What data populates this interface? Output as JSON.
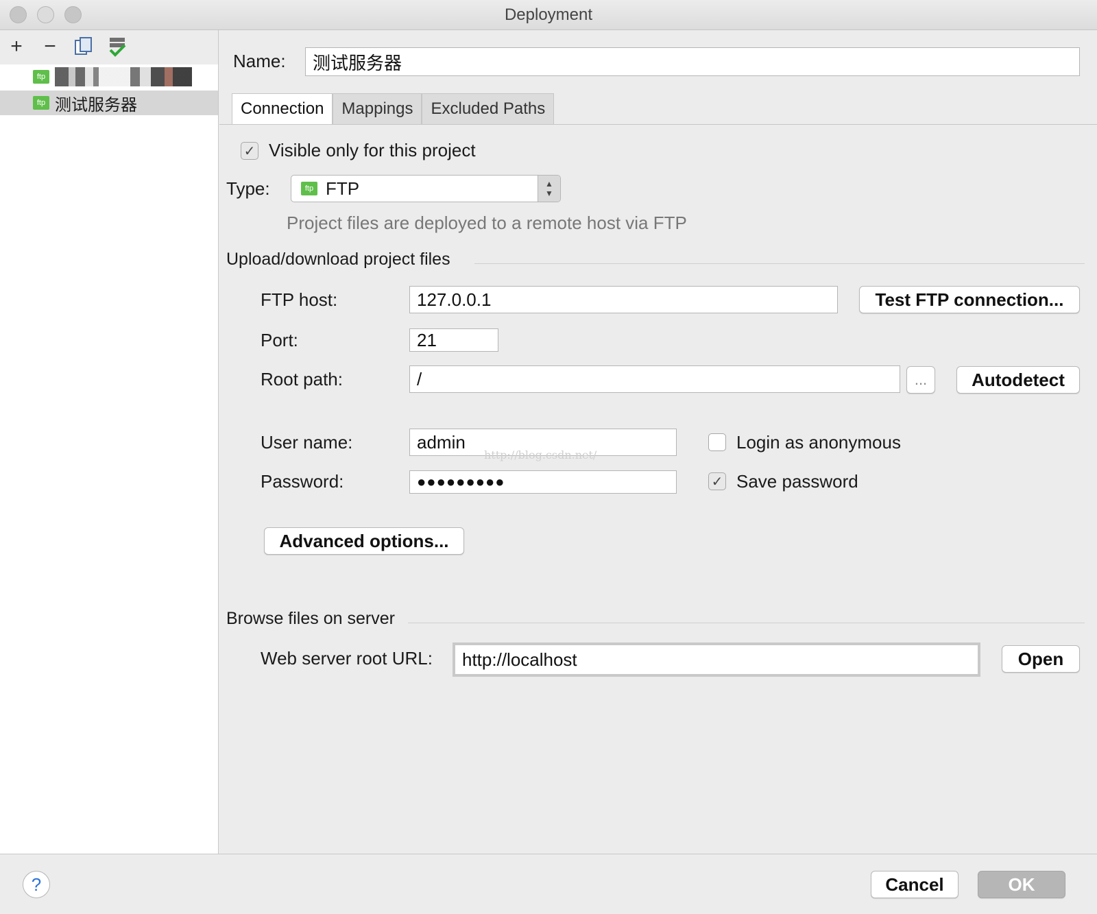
{
  "window": {
    "title": "Deployment"
  },
  "toolbar": {
    "add_icon": "+",
    "remove_icon": "−",
    "copy_icon": "copy-icon",
    "default_icon": "check-server-icon"
  },
  "servers": [
    {
      "name": "",
      "type_badge": "ftp"
    },
    {
      "name": "测试服务器",
      "type_badge": "ftp"
    }
  ],
  "form": {
    "name_label": "Name:",
    "name_value": "测试服务器",
    "tabs": [
      {
        "label": "Connection"
      },
      {
        "label": "Mappings"
      },
      {
        "label": "Excluded Paths"
      }
    ],
    "visible_only_label": "Visible only for this project",
    "visible_only_checked": "✓",
    "type_label": "Type:",
    "type_value": "FTP",
    "type_badge": "ftp",
    "type_hint": "Project files are deployed to a remote host via FTP",
    "upload_section": "Upload/download project files",
    "ftp_host_label": "FTP host:",
    "ftp_host_value": "127.0.0.1",
    "test_button": "Test FTP connection...",
    "port_label": "Port:",
    "port_value": "21",
    "root_path_label": "Root path:",
    "root_path_value": "/",
    "browse_button": "...",
    "autodetect_button": "Autodetect",
    "user_label": "User name:",
    "user_value": "admin",
    "anonymous_label": "Login as anonymous",
    "password_label": "Password:",
    "password_value": "●●●●●●●●●",
    "save_password_label": "Save password",
    "save_password_checked": "✓",
    "advanced_button": "Advanced options...",
    "browse_section": "Browse files on server",
    "web_root_label": "Web server root URL:",
    "web_root_value": "http://localhost",
    "open_button": "Open",
    "watermark": "http://blog.csdn.net/"
  },
  "footer": {
    "help_icon": "?",
    "cancel_button": "Cancel",
    "ok_button": "OK"
  }
}
